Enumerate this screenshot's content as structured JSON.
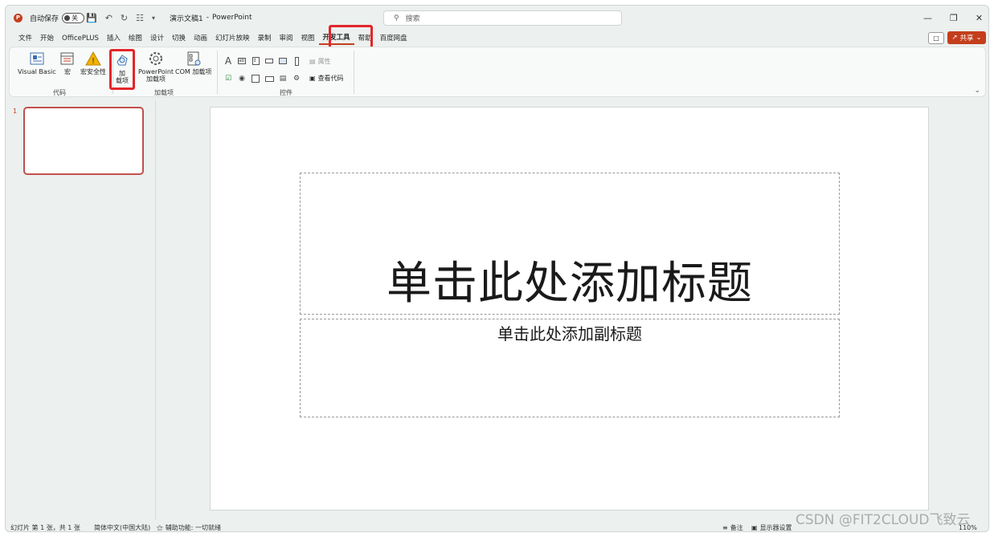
{
  "titlebar": {
    "autosave_label": "自动保存",
    "autosave_state": "关",
    "doc_title": "演示文稿1",
    "separator": "-",
    "app_name": "PowerPoint",
    "search_placeholder": "搜索"
  },
  "tabs": [
    {
      "label": "文件"
    },
    {
      "label": "开始"
    },
    {
      "label": "OfficePLUS"
    },
    {
      "label": "插入"
    },
    {
      "label": "绘图"
    },
    {
      "label": "设计"
    },
    {
      "label": "切换"
    },
    {
      "label": "动画"
    },
    {
      "label": "幻灯片放映"
    },
    {
      "label": "录制"
    },
    {
      "label": "审阅"
    },
    {
      "label": "视图"
    },
    {
      "label": "开发工具",
      "active": true
    },
    {
      "label": "帮助"
    },
    {
      "label": "百度网盘"
    }
  ],
  "share_label": "共享",
  "ribbon": {
    "code_group": {
      "label": "代码",
      "visual_basic": "Visual Basic",
      "macro": "宏",
      "macro_security": "宏安全性"
    },
    "addins_group": {
      "label": "加载项",
      "addins_line1": "加",
      "addins_line2": "载项",
      "ppt_addins_line1": "PowerPoint",
      "ppt_addins_line2": "加载项",
      "com_addins": "COM 加载项"
    },
    "controls_group": {
      "label": "控件",
      "properties": "属性",
      "view_code": "查看代码"
    }
  },
  "thumbnails": {
    "number": "1"
  },
  "slide": {
    "title_placeholder": "单击此处添加标题",
    "subtitle_placeholder": "单击此处添加副标题"
  },
  "statusbar": {
    "slide_info": "幻灯片 第 1 张，共 1 张",
    "language": "简体中文(中国大陆)",
    "accessibility": "辅助功能: 一切就绪",
    "notes": "备注",
    "display_settings": "显示器设置",
    "zoom": "110%"
  },
  "watermark": "CSDN @FIT2CLOUD飞致云",
  "colors": {
    "accent": "#c43e1c",
    "highlight": "#e2262b"
  }
}
